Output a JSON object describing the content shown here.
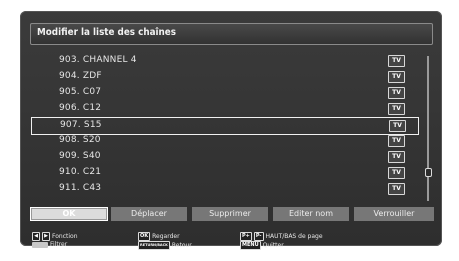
{
  "title": "Modifier la liste des chaînes",
  "channels": [
    {
      "label": "903. CHANNEL 4",
      "badge": "TV",
      "selected": false
    },
    {
      "label": "904. ZDF",
      "badge": "TV",
      "selected": false
    },
    {
      "label": "905. C07",
      "badge": "TV",
      "selected": false
    },
    {
      "label": "906. C12",
      "badge": "TV",
      "selected": false
    },
    {
      "label": "907. S15",
      "badge": "TV",
      "selected": true
    },
    {
      "label": "908. S20",
      "badge": "TV",
      "selected": false
    },
    {
      "label": "909. S40",
      "badge": "TV",
      "selected": false
    },
    {
      "label": "910. C21",
      "badge": "TV",
      "selected": false
    },
    {
      "label": "911. C43",
      "badge": "TV",
      "selected": false
    }
  ],
  "buttons": {
    "ok": "OK",
    "move": "Déplacer",
    "delete": "Supprimer",
    "edit_name": "Editer nom",
    "lock": "Verrouiller"
  },
  "legend": {
    "function_label": "Fonction",
    "filter_label": "Filtrer",
    "ok_key": "OK",
    "watch_label": "Regarder",
    "return_key": "RETURN/BACK",
    "return_label": "Retour",
    "page_key_plus": "P+",
    "page_key_minus": "P-",
    "page_label": "HAUT/BAS de page",
    "menu_key": "MENU",
    "quit_label": "Quitter"
  },
  "colors": {
    "background": "#ffffff",
    "panel": "#3a3a3a",
    "button": "#777777",
    "button_active": "#dcdcdc"
  }
}
